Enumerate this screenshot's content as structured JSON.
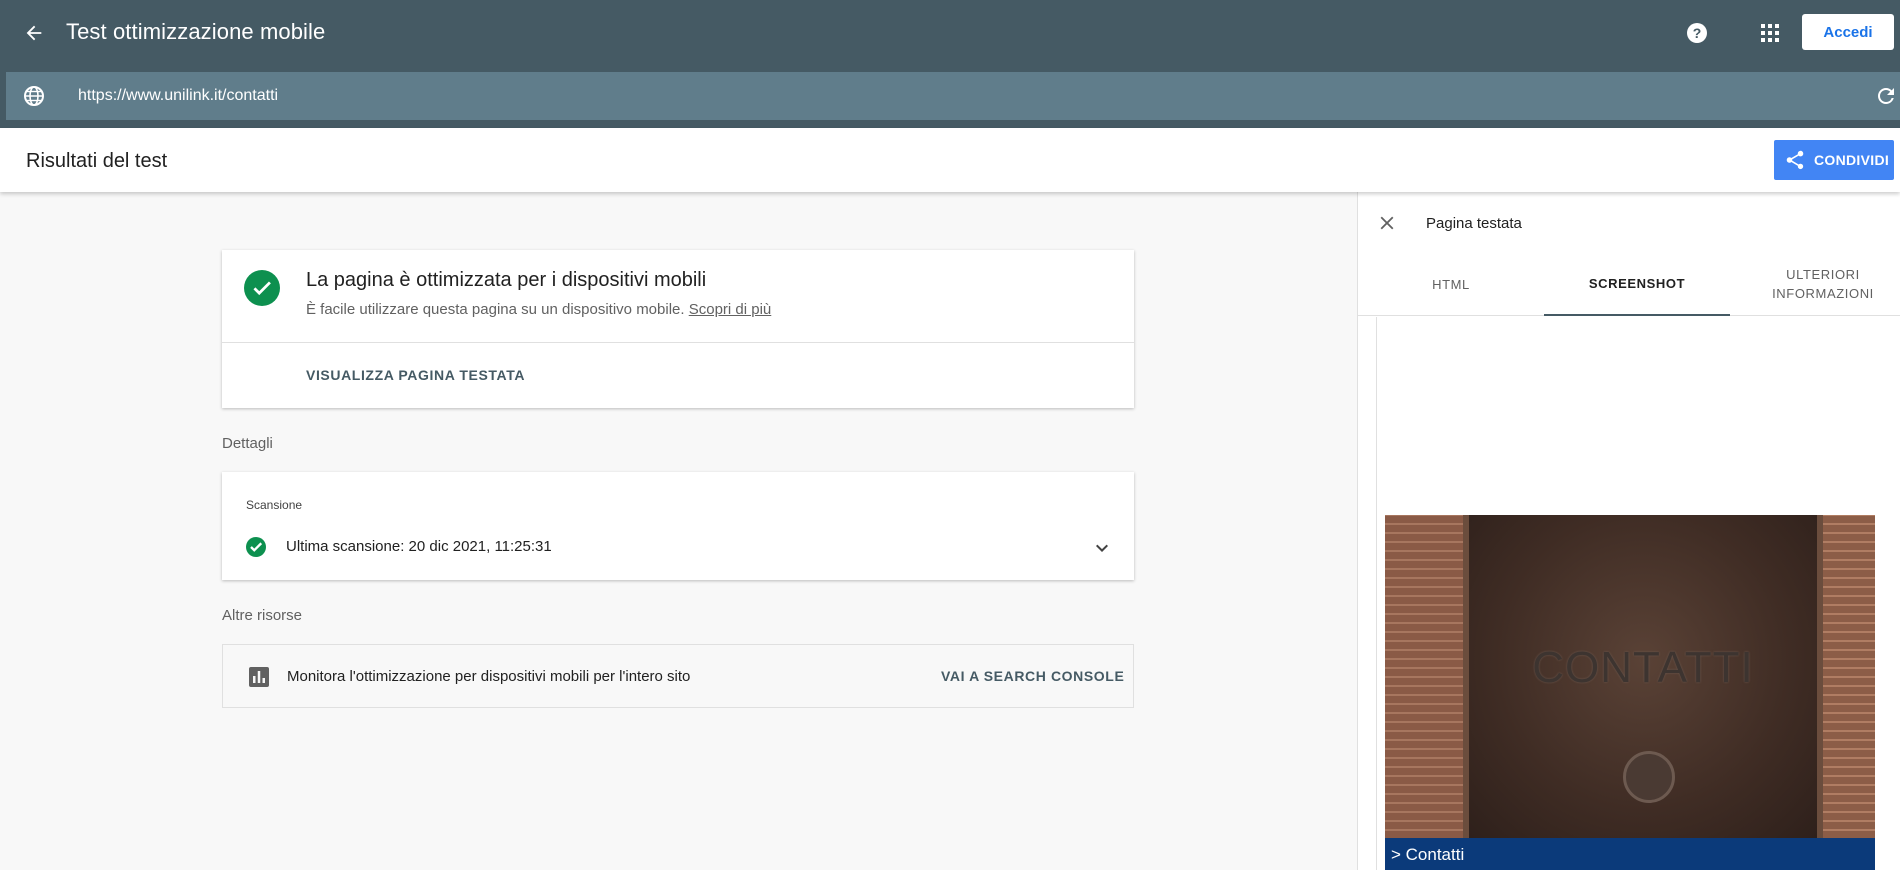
{
  "appbar": {
    "title": "Test ottimizzazione mobile",
    "signin_label": "Accedi",
    "url": "https://www.unilink.it/contatti"
  },
  "header": {
    "title": "Risultati del test",
    "share_label": "CONDIVIDI"
  },
  "result": {
    "heading": "La pagina è ottimizzata per i dispositivi mobili",
    "subtitle": "È facile utilizzare questa pagina su un dispositivo mobile.",
    "learn_more": "Scopri di più",
    "view_page_label": "VISUALIZZA PAGINA TESTATA"
  },
  "details": {
    "section_label": "Dettagli",
    "scan_title": "Scansione",
    "last_scan": "Ultima scansione: 20 dic 2021, 11:25:31"
  },
  "resources": {
    "section_label": "Altre risorse",
    "text": "Monitora l'ottimizzazione per dispositivi mobili per l'intero sito",
    "action_label": "VAI A SEARCH CONSOLE"
  },
  "panel": {
    "title": "Pagina testata",
    "tabs": [
      {
        "label": "HTML"
      },
      {
        "label": "SCREENSHOT",
        "active": true
      },
      {
        "label": "ULTERIORI INFORMAZIONI"
      }
    ],
    "screenshot_caption": "CONTATTI",
    "screenshot_bar_text": "> Contatti"
  },
  "colors": {
    "appbar": "#455a64",
    "urlbar": "#607d8b",
    "success": "#0d904f",
    "share": "#4285f4"
  },
  "icons": [
    "arrow-back-icon",
    "help-icon",
    "apps-grid-icon",
    "globe-icon",
    "reload-icon",
    "share-icon",
    "check-circle-icon",
    "chevron-down-icon",
    "bar-chart-icon",
    "close-icon"
  ]
}
